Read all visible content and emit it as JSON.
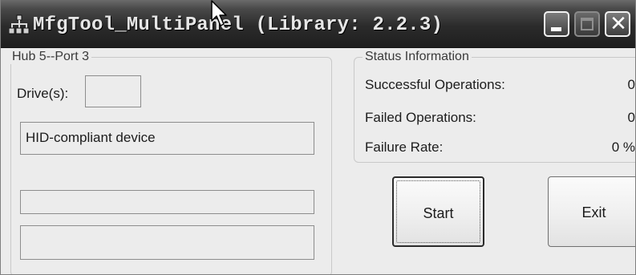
{
  "window": {
    "title": "MfgTool_MultiPanel (Library: 2.2.3)",
    "icon": "network-hierarchy-icon",
    "controls": {
      "minimize_icon": "minimize-icon",
      "maximize_icon": "maximize-icon",
      "close_label": "✕"
    }
  },
  "hub_panel": {
    "title": "Hub 5--Port 3",
    "drives_label": "Drive(s):",
    "drives_value": "",
    "device_name": "HID-compliant device",
    "status_line_1": "",
    "status_line_2": ""
  },
  "status_panel": {
    "title": "Status Information",
    "rows": [
      {
        "label": "Successful Operations:",
        "value": "0"
      },
      {
        "label": "Failed Operations:",
        "value": "0"
      },
      {
        "label": "Failure Rate:",
        "value": "0 %"
      }
    ]
  },
  "buttons": {
    "start_label": "Start",
    "exit_label": "Exit"
  },
  "colors": {
    "titlebar": "#2b2b2b",
    "window_bg": "#ececec",
    "border": "#8d8d8d"
  }
}
